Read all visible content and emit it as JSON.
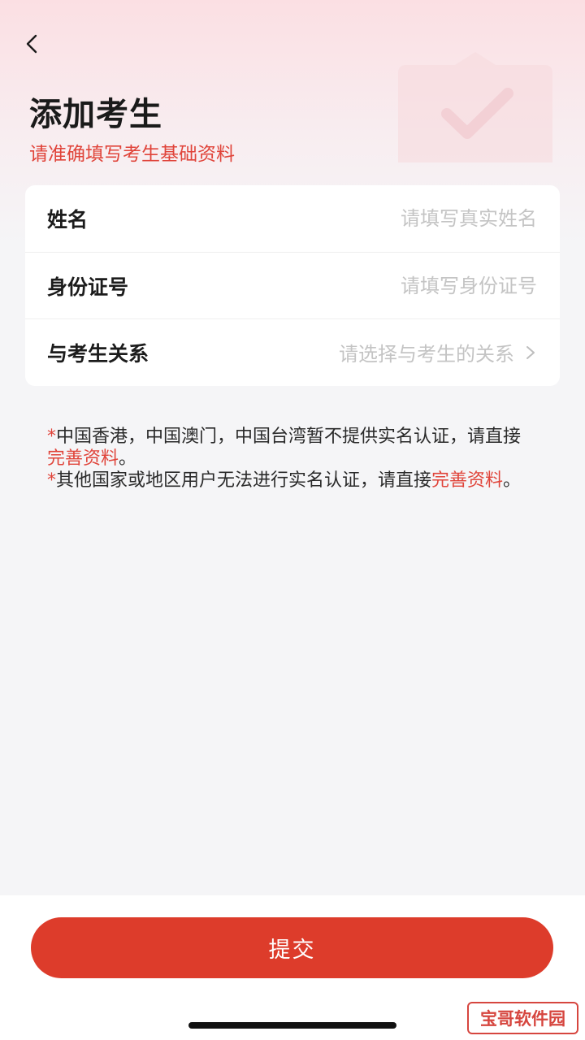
{
  "header": {
    "title": "添加考生",
    "subtitle": "请准确填写考生基础资料"
  },
  "form": {
    "name": {
      "label": "姓名",
      "placeholder": "请填写真实姓名"
    },
    "id_number": {
      "label": "身份证号",
      "placeholder": "请填写身份证号"
    },
    "relation": {
      "label": "与考生关系",
      "placeholder": "请选择与考生的关系"
    }
  },
  "notes": {
    "star": "*",
    "line1_text": "中国香港，中国澳门，中国台湾暂不提供实名认证，请直接",
    "line1_link": "完善资料",
    "line1_end": "。",
    "line2_text": "其他国家或地区用户无法进行实名认证，请直接",
    "line2_link": "完善资料",
    "line2_end": "。"
  },
  "submit_label": "提交",
  "watermark": "宝哥软件园",
  "colors": {
    "accent": "#e0443a",
    "submit": "#dd3c2b",
    "background": "#f5f5f7"
  },
  "icons": {
    "back": "chevron-left-icon",
    "relation_arrow": "chevron-right-icon",
    "decoration": "shield-check-icon"
  }
}
